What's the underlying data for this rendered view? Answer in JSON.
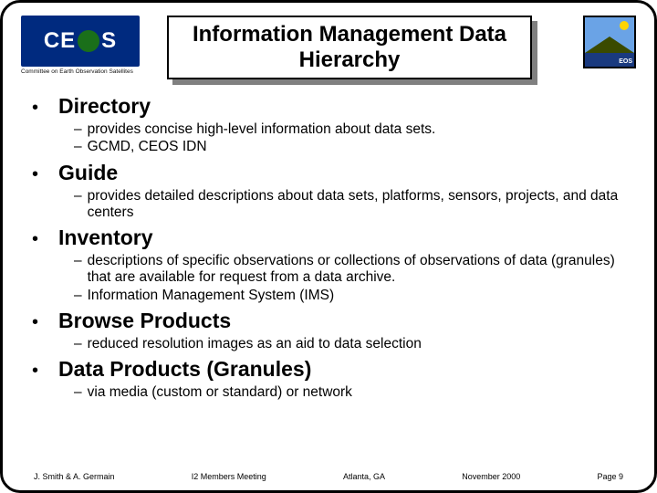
{
  "header": {
    "logo_left": "CE   S",
    "logo_caption": "Committee on Earth Observation Satellites",
    "title": "Information Management Data Hierarchy",
    "logo_right_label": "EOS"
  },
  "items": [
    {
      "title": "Directory",
      "subs": [
        "provides concise high-level information about data sets.",
        "GCMD, CEOS IDN"
      ]
    },
    {
      "title": "Guide",
      "subs": [
        "provides detailed descriptions about data sets, platforms, sensors, projects, and data centers"
      ]
    },
    {
      "title": "Inventory",
      "subs": [
        "descriptions of specific observations or collections of observations of data (granules) that are available for request from a data archive.",
        "Information Management System (IMS)"
      ]
    },
    {
      "title": "Browse Products",
      "subs": [
        "reduced resolution images as an aid to data selection"
      ]
    },
    {
      "title": "Data Products (Granules)",
      "subs": [
        "via media (custom or standard) or network"
      ]
    }
  ],
  "footer": {
    "authors": "J. Smith & A. Germain",
    "meeting": "I2 Members Meeting",
    "location": "Atlanta, GA",
    "date": "November 2000",
    "page": "Page 9"
  }
}
